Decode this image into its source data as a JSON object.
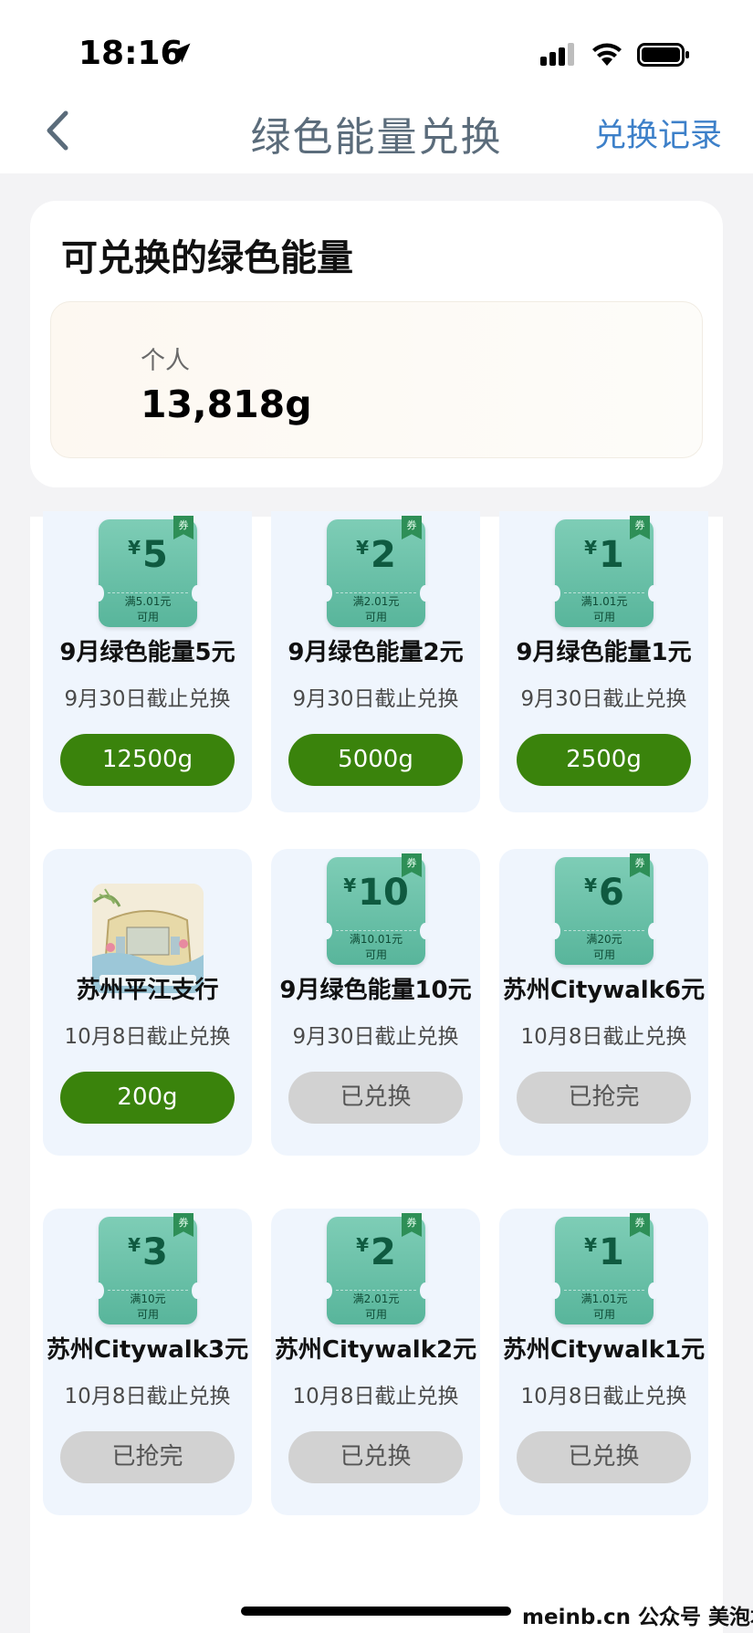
{
  "status": {
    "time": "18:16"
  },
  "nav": {
    "title": "绿色能量兑换",
    "right_link": "兑换记录"
  },
  "energy": {
    "title": "可兑换的绿色能量",
    "label": "个人",
    "value": "13,818g"
  },
  "items": [
    {
      "kind": "coupon",
      "amount": "5",
      "cond1": "满5.01元",
      "cond2": "可用",
      "ribbon": "券",
      "title": "9月绿色能量5元",
      "deadline": "9月30日截止兑换",
      "button": "12500g",
      "state": "available"
    },
    {
      "kind": "coupon",
      "amount": "2",
      "cond1": "满2.01元",
      "cond2": "可用",
      "ribbon": "券",
      "title": "9月绿色能量2元",
      "deadline": "9月30日截止兑换",
      "button": "5000g",
      "state": "available"
    },
    {
      "kind": "coupon",
      "amount": "1",
      "cond1": "满1.01元",
      "cond2": "可用",
      "ribbon": "券",
      "title": "9月绿色能量1元",
      "deadline": "9月30日截止兑换",
      "button": "2500g",
      "state": "available"
    },
    {
      "kind": "image",
      "title": "苏州平江支行",
      "deadline": "10月8日截止兑换",
      "button": "200g",
      "state": "available"
    },
    {
      "kind": "coupon",
      "amount": "10",
      "cond1": "满10.01元",
      "cond2": "可用",
      "ribbon": "券",
      "title": "9月绿色能量10元",
      "deadline": "9月30日截止兑换",
      "button": "已兑换",
      "state": "redeemed"
    },
    {
      "kind": "coupon",
      "amount": "6",
      "cond1": "满20元",
      "cond2": "可用",
      "ribbon": "券",
      "title": "苏州Citywalk6元",
      "deadline": "10月8日截止兑换",
      "button": "已抢完",
      "state": "soldout"
    },
    {
      "kind": "coupon",
      "amount": "3",
      "cond1": "满10元",
      "cond2": "可用",
      "ribbon": "券",
      "title": "苏州Citywalk3元",
      "deadline": "10月8日截止兑换",
      "button": "已抢完",
      "state": "soldout"
    },
    {
      "kind": "coupon",
      "amount": "2",
      "cond1": "满2.01元",
      "cond2": "可用",
      "ribbon": "券",
      "title": "苏州Citywalk2元",
      "deadline": "10月8日截止兑换",
      "button": "已兑换",
      "state": "redeemed"
    },
    {
      "kind": "coupon",
      "amount": "1",
      "cond1": "满1.01元",
      "cond2": "可用",
      "ribbon": "券",
      "title": "苏州Citywalk1元",
      "deadline": "10月8日截止兑换",
      "button": "已兑换",
      "state": "redeemed"
    }
  ],
  "coupon_currency": "¥",
  "watermark": "meinb.cn  公众号 美泡君",
  "colors": {
    "accent_green": "#3a830c",
    "disabled_gray": "#d2d2d2",
    "link_blue": "#3d80c9"
  }
}
